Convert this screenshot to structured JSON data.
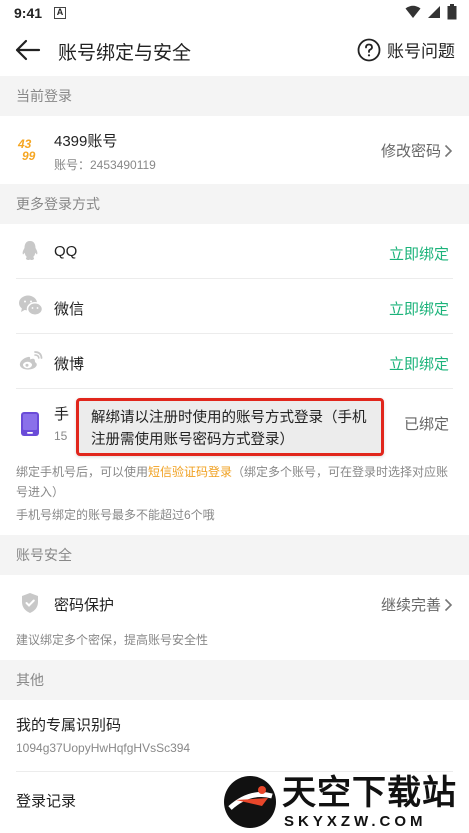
{
  "status_bar": {
    "time": "9:41",
    "app_icon_letter": "A"
  },
  "header": {
    "title": "账号绑定与安全",
    "help_label": "账号问题"
  },
  "sections": {
    "current_login": "当前登录",
    "more_methods": "更多登录方式",
    "account_security": "账号安全",
    "other": "其他"
  },
  "current_account": {
    "logo_text_top": "43",
    "logo_text_bottom": "99",
    "name": "4399账号",
    "account_label": "账号：2453490119",
    "action": "修改密码"
  },
  "login_methods": [
    {
      "icon": "qq-icon",
      "label": "QQ",
      "action": "立即绑定"
    },
    {
      "icon": "wechat-icon",
      "label": "微信",
      "action": "立即绑定"
    },
    {
      "icon": "weibo-icon",
      "label": "微博",
      "action": "立即绑定"
    }
  ],
  "phone": {
    "label_visible": "手",
    "number_visible": "15",
    "status": "已绑定"
  },
  "phone_note": {
    "part1": "绑定手机号后，可以使用",
    "link": "短信验证码登录",
    "part2": "（绑定多个账号，可在登录时选择对应账号进入）",
    "line2": "手机号绑定的账号最多不能超过6个哦"
  },
  "security": {
    "label": "密码保护",
    "action": "继续完善",
    "note": "建议绑定多个密保，提高账号安全性"
  },
  "other": {
    "id_label": "我的专属识别码",
    "id_value": "1094g37UopyHwHqfgHVsSc394",
    "login_record": "登录记录"
  },
  "toast": {
    "text": "解绑请以注册时使用的账号方式登录（手机注册需使用账号密码方式登录）"
  },
  "watermark": {
    "brand": "天空下载站",
    "domain_text": "SKYXZW.COM"
  },
  "colors": {
    "accent_green": "#1bb37a",
    "link_orange": "#f0a020",
    "highlight_red": "#e1261c",
    "section_bg": "#f4f4f4"
  }
}
